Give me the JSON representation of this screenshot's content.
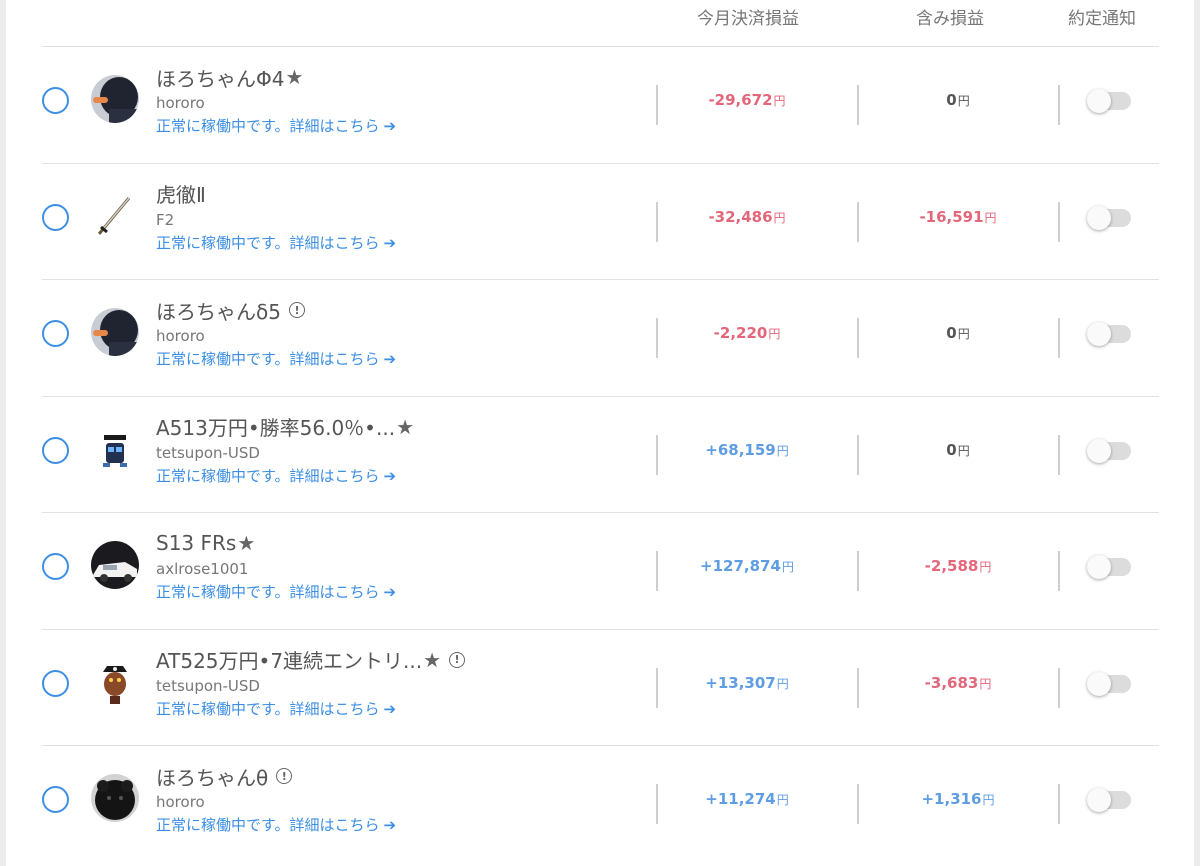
{
  "header": {
    "settled_label": "今月決済損益",
    "unrealized_label": "含み損益",
    "notify_label": "約定通知"
  },
  "rows": [
    {
      "title": "ほろちゃんΦ4",
      "star": "★",
      "info": "",
      "sub": "hororo",
      "status": "正常に稼働中です。詳細はこちら",
      "settled": "-29,672",
      "settled_sign": "neg",
      "unrealized": "0",
      "unrealized_sign": "zero",
      "avatar": "dark-person",
      "notify": false
    },
    {
      "title": "虎徹Ⅱ",
      "star": "",
      "info": "",
      "sub": "F2",
      "status": "正常に稼働中です。詳細はこちら",
      "settled": "-32,486",
      "settled_sign": "neg",
      "unrealized": "-16,591",
      "unrealized_sign": "neg",
      "avatar": "katana",
      "notify": false
    },
    {
      "title": "ほろちゃんδ5",
      "star": "",
      "info": "!",
      "sub": "hororo",
      "status": "正常に稼働中です。詳細はこちら",
      "settled": "-2,220",
      "settled_sign": "neg",
      "unrealized": "0",
      "unrealized_sign": "zero",
      "avatar": "dark-person",
      "notify": false
    },
    {
      "title": "A513万円•勝率56.0％•...",
      "star": "★",
      "info": "",
      "sub": "tetsupon-USD",
      "status": "正常に稼働中です。詳細はこちら",
      "settled": "+68,159",
      "settled_sign": "pos",
      "unrealized": "0",
      "unrealized_sign": "zero",
      "avatar": "robot",
      "notify": false
    },
    {
      "title": "S13 FRs",
      "star": "★",
      "info": "",
      "sub": "axlrose1001",
      "status": "正常に稼働中です。詳細はこちら",
      "settled": "+127,874",
      "settled_sign": "pos",
      "unrealized": "-2,588",
      "unrealized_sign": "neg",
      "avatar": "car",
      "notify": false
    },
    {
      "title": "AT525万円•7連続エントリ...",
      "star": "★",
      "info": "!",
      "sub": "tetsupon-USD",
      "status": "正常に稼働中です。詳細はこちら",
      "settled": "+13,307",
      "settled_sign": "pos",
      "unrealized": "-3,683",
      "unrealized_sign": "neg",
      "avatar": "pirate",
      "notify": false
    },
    {
      "title": "ほろちゃんθ",
      "star": "",
      "info": "!",
      "sub": "hororo",
      "status": "正常に稼働中です。詳細はこちら",
      "settled": "+11,274",
      "settled_sign": "pos",
      "unrealized": "+1,316",
      "unrealized_sign": "pos",
      "avatar": "dark-animal",
      "notify": false
    }
  ],
  "currency_unit": "円",
  "status_arrow": "➔",
  "colors": {
    "accent_blue": "#3d8fe4",
    "negative": "#e3667b",
    "positive": "#5f9de2"
  }
}
